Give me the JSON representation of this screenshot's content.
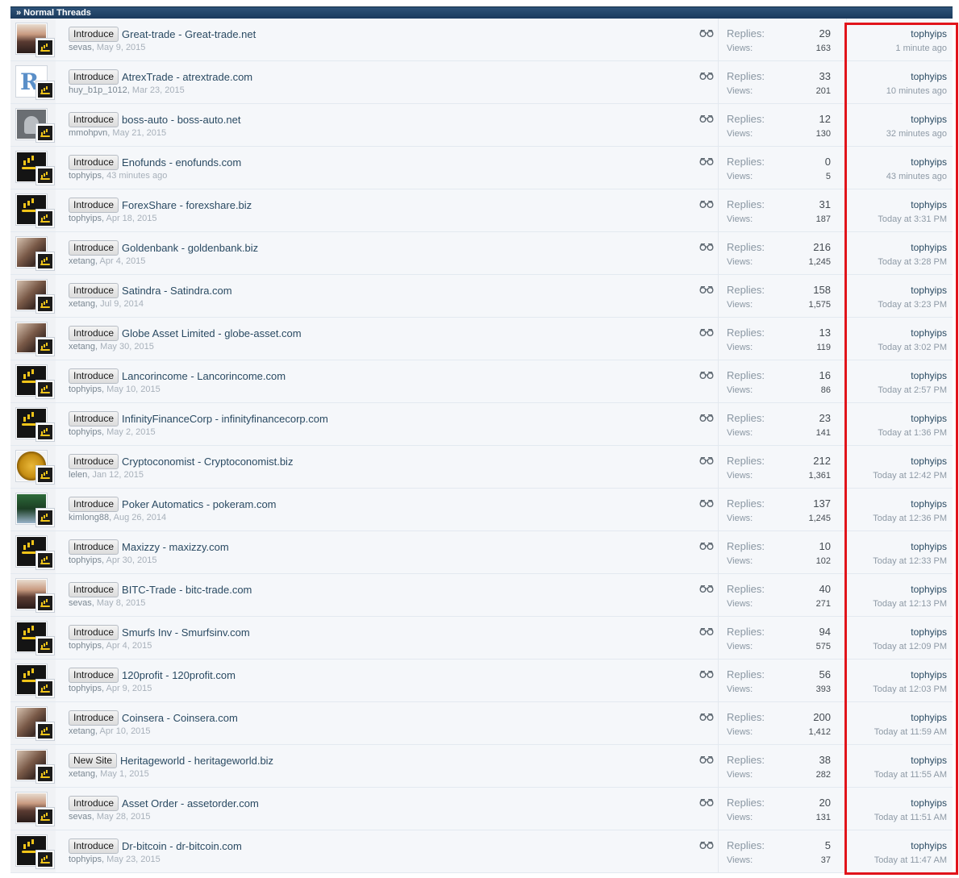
{
  "section": {
    "title": "» Normal Threads"
  },
  "threads": [
    {
      "prefix": "Introduce",
      "title": "Great-trade - Great-trade.net",
      "author": "sevas",
      "date": "May 9, 2015",
      "replies_label": "Replies:",
      "replies": "29",
      "views_label": "Views:",
      "views": "163",
      "last_user": "tophyips",
      "last_date": "1 minute ago",
      "avatar": "woman"
    },
    {
      "prefix": "Introduce",
      "title": "AtrexTrade - atrextrade.com",
      "author": "huy_b1p_1012",
      "date": "Mar 23, 2015",
      "replies_label": "Replies:",
      "replies": "33",
      "views_label": "Views:",
      "views": "201",
      "last_user": "tophyips",
      "last_date": "10 minutes ago",
      "avatar": "r-logo"
    },
    {
      "prefix": "Introduce",
      "title": "boss-auto - boss-auto.net",
      "author": "mmohpvn",
      "date": "May 21, 2015",
      "replies_label": "Replies:",
      "replies": "12",
      "views_label": "Views:",
      "views": "130",
      "last_user": "tophyips",
      "last_date": "32 minutes ago",
      "avatar": "gray"
    },
    {
      "prefix": "Introduce",
      "title": "Enofunds - enofunds.com",
      "author": "tophyips",
      "date": "43 minutes ago",
      "replies_label": "Replies:",
      "replies": "0",
      "views_label": "Views:",
      "views": "5",
      "last_user": "tophyips",
      "last_date": "43 minutes ago",
      "avatar": "logo"
    },
    {
      "prefix": "Introduce",
      "title": "ForexShare - forexshare.biz",
      "author": "tophyips",
      "date": "Apr 18, 2015",
      "replies_label": "Replies:",
      "replies": "31",
      "views_label": "Views:",
      "views": "187",
      "last_user": "tophyips",
      "last_date": "Today at 3:31 PM",
      "avatar": "logo"
    },
    {
      "prefix": "Introduce",
      "title": "Goldenbank - goldenbank.biz",
      "author": "xetang",
      "date": "Apr 4, 2015",
      "replies_label": "Replies:",
      "replies": "216",
      "views_label": "Views:",
      "views": "1,245",
      "last_user": "tophyips",
      "last_date": "Today at 3:28 PM",
      "avatar": "couple"
    },
    {
      "prefix": "Introduce",
      "title": "Satindra - Satindra.com",
      "author": "xetang",
      "date": "Jul 9, 2014",
      "replies_label": "Replies:",
      "replies": "158",
      "views_label": "Views:",
      "views": "1,575",
      "last_user": "tophyips",
      "last_date": "Today at 3:23 PM",
      "avatar": "couple"
    },
    {
      "prefix": "Introduce",
      "title": "Globe Asset Limited - globe-asset.com",
      "author": "xetang",
      "date": "May 30, 2015",
      "replies_label": "Replies:",
      "replies": "13",
      "views_label": "Views:",
      "views": "119",
      "last_user": "tophyips",
      "last_date": "Today at 3:02 PM",
      "avatar": "couple"
    },
    {
      "prefix": "Introduce",
      "title": "Lancorincome - Lancorincome.com",
      "author": "tophyips",
      "date": "May 10, 2015",
      "replies_label": "Replies:",
      "replies": "16",
      "views_label": "Views:",
      "views": "86",
      "last_user": "tophyips",
      "last_date": "Today at 2:57 PM",
      "avatar": "logo"
    },
    {
      "prefix": "Introduce",
      "title": "InfinityFinanceCorp - infinityfinancecorp.com",
      "author": "tophyips",
      "date": "May 2, 2015",
      "replies_label": "Replies:",
      "replies": "23",
      "views_label": "Views:",
      "views": "141",
      "last_user": "tophyips",
      "last_date": "Today at 1:36 PM",
      "avatar": "logo"
    },
    {
      "prefix": "Introduce",
      "title": "Cryptoconomist - Cryptoconomist.biz",
      "author": "lelen",
      "date": "Jan 12, 2015",
      "replies_label": "Replies:",
      "replies": "212",
      "views_label": "Views:",
      "views": "1,361",
      "last_user": "tophyips",
      "last_date": "Today at 12:42 PM",
      "avatar": "coin"
    },
    {
      "prefix": "Introduce",
      "title": "Poker Automatics - pokeram.com",
      "author": "kimlong88",
      "date": "Aug 26, 2014",
      "replies_label": "Replies:",
      "replies": "137",
      "views_label": "Views:",
      "views": "1,245",
      "last_user": "tophyips",
      "last_date": "Today at 12:36 PM",
      "avatar": "poker"
    },
    {
      "prefix": "Introduce",
      "title": "Maxizzy - maxizzy.com",
      "author": "tophyips",
      "date": "Apr 30, 2015",
      "replies_label": "Replies:",
      "replies": "10",
      "views_label": "Views:",
      "views": "102",
      "last_user": "tophyips",
      "last_date": "Today at 12:33 PM",
      "avatar": "logo"
    },
    {
      "prefix": "Introduce",
      "title": "BITC-Trade - bitc-trade.com",
      "author": "sevas",
      "date": "May 8, 2015",
      "replies_label": "Replies:",
      "replies": "40",
      "views_label": "Views:",
      "views": "271",
      "last_user": "tophyips",
      "last_date": "Today at 12:13 PM",
      "avatar": "woman"
    },
    {
      "prefix": "Introduce",
      "title": "Smurfs Inv - Smurfsinv.com",
      "author": "tophyips",
      "date": "Apr 4, 2015",
      "replies_label": "Replies:",
      "replies": "94",
      "views_label": "Views:",
      "views": "575",
      "last_user": "tophyips",
      "last_date": "Today at 12:09 PM",
      "avatar": "logo"
    },
    {
      "prefix": "Introduce",
      "title": "120profit - 120profit.com",
      "author": "tophyips",
      "date": "Apr 9, 2015",
      "replies_label": "Replies:",
      "replies": "56",
      "views_label": "Views:",
      "views": "393",
      "last_user": "tophyips",
      "last_date": "Today at 12:03 PM",
      "avatar": "logo"
    },
    {
      "prefix": "Introduce",
      "title": "Coinsera - Coinsera.com",
      "author": "xetang",
      "date": "Apr 10, 2015",
      "replies_label": "Replies:",
      "replies": "200",
      "views_label": "Views:",
      "views": "1,412",
      "last_user": "tophyips",
      "last_date": "Today at 11:59 AM",
      "avatar": "couple"
    },
    {
      "prefix": "New Site",
      "title": "Heritageworld - heritageworld.biz",
      "author": "xetang",
      "date": "May 1, 2015",
      "replies_label": "Replies:",
      "replies": "38",
      "views_label": "Views:",
      "views": "282",
      "last_user": "tophyips",
      "last_date": "Today at 11:55 AM",
      "avatar": "couple"
    },
    {
      "prefix": "Introduce",
      "title": "Asset Order - assetorder.com",
      "author": "sevas",
      "date": "May 28, 2015",
      "replies_label": "Replies:",
      "replies": "20",
      "views_label": "Views:",
      "views": "131",
      "last_user": "tophyips",
      "last_date": "Today at 11:51 AM",
      "avatar": "woman"
    },
    {
      "prefix": "Introduce",
      "title": "Dr-bitcoin - dr-bitcoin.com",
      "author": "tophyips",
      "date": "May 23, 2015",
      "replies_label": "Replies:",
      "replies": "5",
      "views_label": "Views:",
      "views": "37",
      "last_user": "tophyips",
      "last_date": "Today at 11:47 AM",
      "avatar": "logo"
    }
  ],
  "colors": {
    "header_bg": "#1b3a5c",
    "highlight": "#e1141b",
    "row_bg": "#f5f7fa"
  },
  "icons": {
    "preview": "glasses-icon"
  }
}
